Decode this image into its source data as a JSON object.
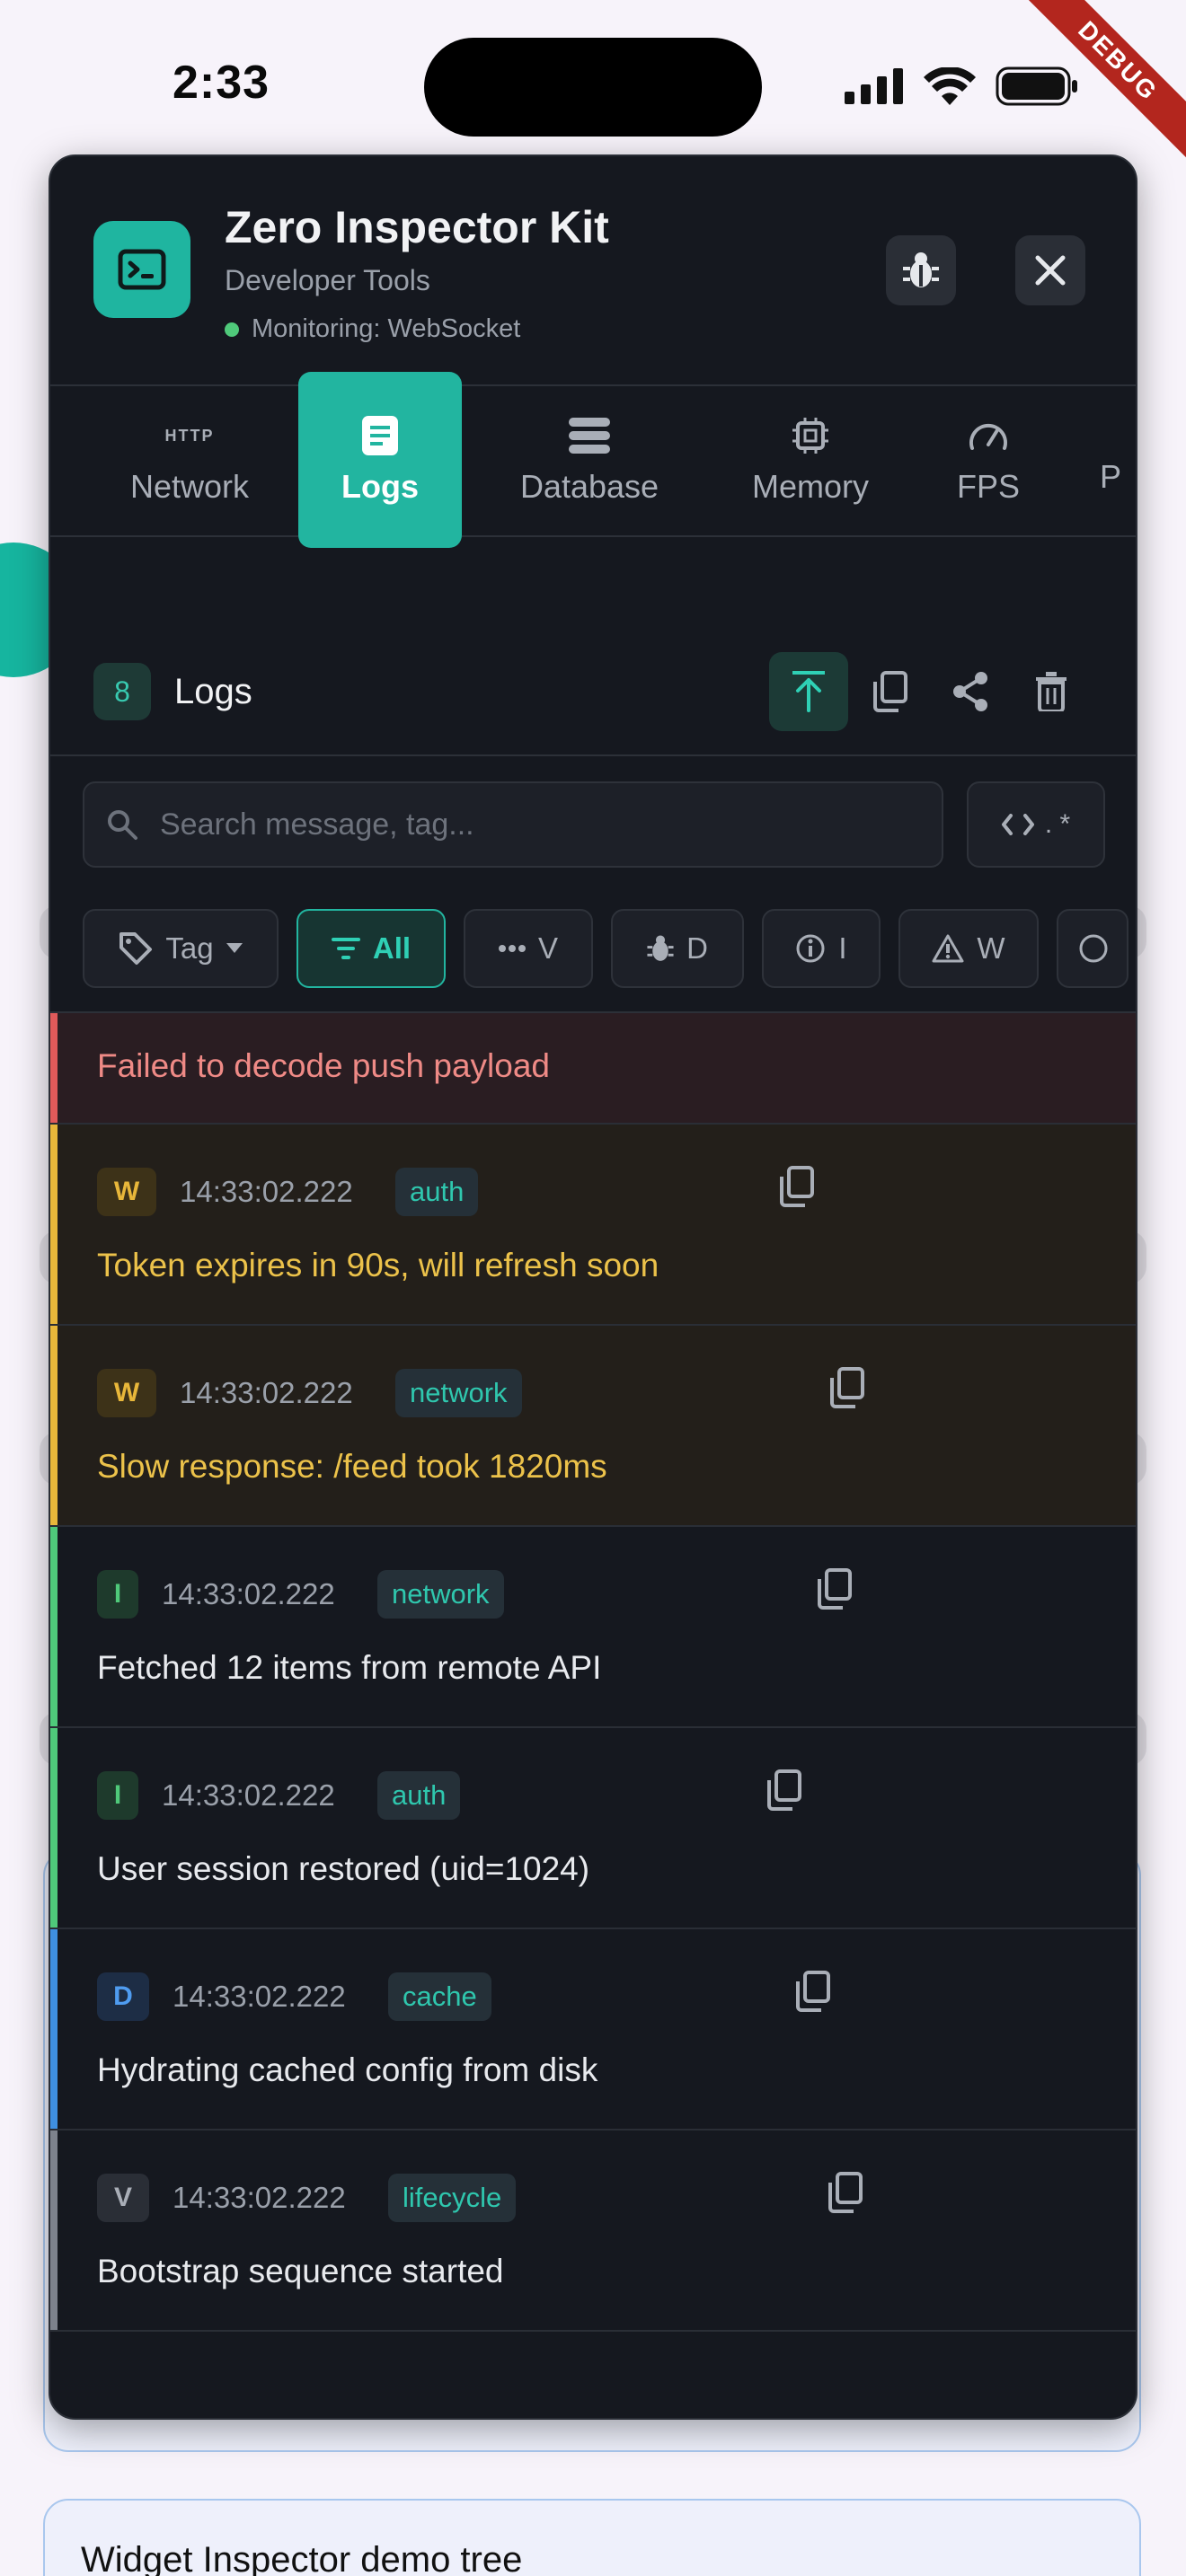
{
  "status": {
    "time": "2:33",
    "ribbon": "DEBUG"
  },
  "header": {
    "title": "Zero Inspector Kit",
    "subtitle": "Developer Tools",
    "monitoring": "Monitoring: WebSocket"
  },
  "tabs": [
    {
      "label": "Network",
      "icon": "http-icon",
      "badge": "HTTP"
    },
    {
      "label": "Logs",
      "icon": "document-icon",
      "active": true
    },
    {
      "label": "Database",
      "icon": "database-icon"
    },
    {
      "label": "Memory",
      "icon": "chip-icon"
    },
    {
      "label": "FPS",
      "icon": "speedometer-icon"
    },
    {
      "label": "P",
      "icon": "partial-tab-icon"
    }
  ],
  "logbar": {
    "count": "8",
    "title": "Logs"
  },
  "search": {
    "placeholder": "Search message, tag...",
    "regex": ". *"
  },
  "filters": {
    "tag": "Tag",
    "all": "All",
    "verbose": "V",
    "debug": "D",
    "info": "I",
    "warn": "W"
  },
  "logs": {
    "error_msg": "Failed to decode push payload",
    "entries": [
      {
        "level": "W",
        "time": "14:33:02.222",
        "tag": "auth",
        "message": "Token expires in 90s, will refresh soon"
      },
      {
        "level": "W",
        "time": "14:33:02.222",
        "tag": "network",
        "message": "Slow response: /feed took 1820ms"
      },
      {
        "level": "I",
        "time": "14:33:02.222",
        "tag": "network",
        "message": "Fetched 12 items from remote API"
      },
      {
        "level": "I",
        "time": "14:33:02.222",
        "tag": "auth",
        "message": "User session restored (uid=1024)"
      },
      {
        "level": "D",
        "time": "14:33:02.222",
        "tag": "cache",
        "message": "Hydrating cached config from disk"
      },
      {
        "level": "V",
        "time": "14:33:02.222",
        "tag": "lifecycle",
        "message": "Bootstrap sequence started"
      }
    ]
  },
  "background": {
    "card_title": "Widget Inspector demo tree"
  },
  "colors": {
    "accent": "#22b5a0",
    "error": "#e05a5a",
    "warn": "#e8b73a",
    "info": "#4fc97a",
    "debug": "#3f8fe0",
    "verbose": "#7d828c"
  }
}
